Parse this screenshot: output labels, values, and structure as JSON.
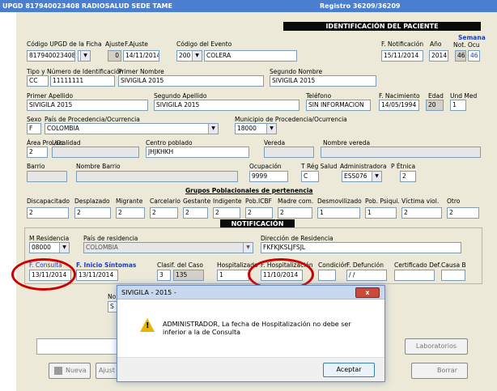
{
  "app": {
    "title": "UPGD 817940023408 RADIOSALUD SEDE TAME",
    "registro": "Registro 36209/36209"
  },
  "sections": {
    "paciente": "IDENTIFICACIÓN DEL PACIENTE",
    "notificacion": "NOTIFICACIÓN"
  },
  "labels": {
    "codigo_upgd": "Código UPGD de la Ficha",
    "ajuste": "Ajuste",
    "f_ajuste": "F.Ajuste",
    "codigo_evento": "Código del Evento",
    "f_notificacion": "F. Notificación",
    "anio": "Año",
    "semana": "Semana",
    "not_ocu": "Not.  Ocu",
    "tipo_num_id": "Tipo y Número de Identificación",
    "primer_nombre": "Primer Nombre",
    "segundo_nombre": "Segundo Nombre",
    "primer_apellido": "Primer Apellido",
    "segundo_apellido": "Segundo Apellido",
    "telefono": "Teléfono",
    "f_nacimiento": "F. Nacimiento",
    "edad": "Edad",
    "und_med": "Und Med",
    "sexo": "Sexo",
    "pais_proc": "País de Procedencia/Ocurrencia",
    "municipio_proc": "Municipio de Procedencia/Ocurrencia",
    "area": "Área Pro./Oc",
    "localidad": "Localidad",
    "centro_poblado": "Centro poblado",
    "vereda": "Vereda",
    "nombre_vereda": "Nombre vereda",
    "barrio": "Barrio",
    "nombre_barrio": "Nombre Barrio",
    "ocupacion": "Ocupación",
    "t_reg_salud": "T Rég Salud",
    "administradora": "Administradora",
    "p_etnica": "P Étnica",
    "grupos": "Grupos Poblacionales de pertenencia",
    "m_residencia": "M Residencia",
    "pais_residencia": "País de residencia",
    "direccion": "Dirección de Residencia",
    "f_consulta": "F. Consulta",
    "f_inicio": "F. Inicio Síntomas",
    "clasif": "Clasif.  del Caso",
    "hospitalizado": "Hospitalizado",
    "f_hosp": "F. Hospitalización",
    "condicion": "Condición",
    "f_defuncion": "F. Defunción",
    "cert_def": "Certificado Def.",
    "causa_b": "Causa B",
    "no_partial": "No",
    "s_partial": "S"
  },
  "fields": {
    "codigo_upgd": "817940023408",
    "ajuste": "0",
    "f_ajuste": "14/11/2014",
    "evento_code": "200",
    "evento_name": "COLERA",
    "f_notificacion": "15/11/2014",
    "anio": "2014",
    "sem_not": "46",
    "sem_ocu": "46",
    "tipo_id": "CC",
    "num_id": "11111111",
    "primer_nombre": "SIVIGILA 2015",
    "segundo_nombre": "SIVIGILA 2015",
    "primer_apellido": "SIVIGILA 2015",
    "segundo_apellido": "SIVIGILA 2015",
    "telefono": "SIN INFORMACION",
    "f_nacimiento": "14/05/1994",
    "edad": "20",
    "und_med": "1",
    "sexo": "F",
    "pais_proc": "COLOMBIA",
    "municipio_proc": "18000",
    "area": "2",
    "localidad": "",
    "centro_poblado": "JHJKHKH",
    "vereda": "",
    "nombre_vereda": "",
    "barrio": "",
    "nombre_barrio": "",
    "ocupacion": "9999",
    "t_reg_salud": "C",
    "administradora": "ESS076",
    "p_etnica": "2",
    "m_residencia": "08000",
    "pais_residencia": "COLOMBIA",
    "direccion": "FKFKJKSLJFSJL",
    "f_consulta": "13/11/2014",
    "f_inicio": "13/11/2014",
    "clasif_code": "3",
    "clasif_val": "135",
    "hospitalizado": "1",
    "f_hosp": "11/10/2014",
    "condicion": "",
    "f_defuncion": " / /",
    "cert_def": "",
    "causa_b": ""
  },
  "grupos": [
    {
      "label": "Discapacitado",
      "value": "2"
    },
    {
      "label": "Desplazado",
      "value": "2"
    },
    {
      "label": "Migrante",
      "value": "2"
    },
    {
      "label": "Carcelario",
      "value": "2"
    },
    {
      "label": "Gestante",
      "value": "2"
    },
    {
      "label": "Indigente",
      "value": "2"
    },
    {
      "label": "Pob.ICBF",
      "value": "2"
    },
    {
      "label": "Madre com.",
      "value": "2"
    },
    {
      "label": "Desmovilizado",
      "value": "1"
    },
    {
      "label": "Pob. Psiqui.",
      "value": "1"
    },
    {
      "label": "Víctima viol.",
      "value": "2"
    },
    {
      "label": "Otro",
      "value": "2"
    }
  ],
  "buttons": {
    "nueva": "Nueva",
    "ajuste": "Ajust",
    "laboratorios": "Laboratorios",
    "borrar": "Borrar"
  },
  "dialog": {
    "title": "SIVIGILA - 2015 -",
    "close": "x",
    "message": "ADMINISTRADOR, La fecha de Hospitalización no debe ser inferior a la de Consulta",
    "accept": "Aceptar"
  },
  "colors": {
    "titlebar": "#4a7fd0",
    "panel": "#ece9d8",
    "section": "#0a0a0a",
    "highlight_oval": "#cc0000"
  }
}
